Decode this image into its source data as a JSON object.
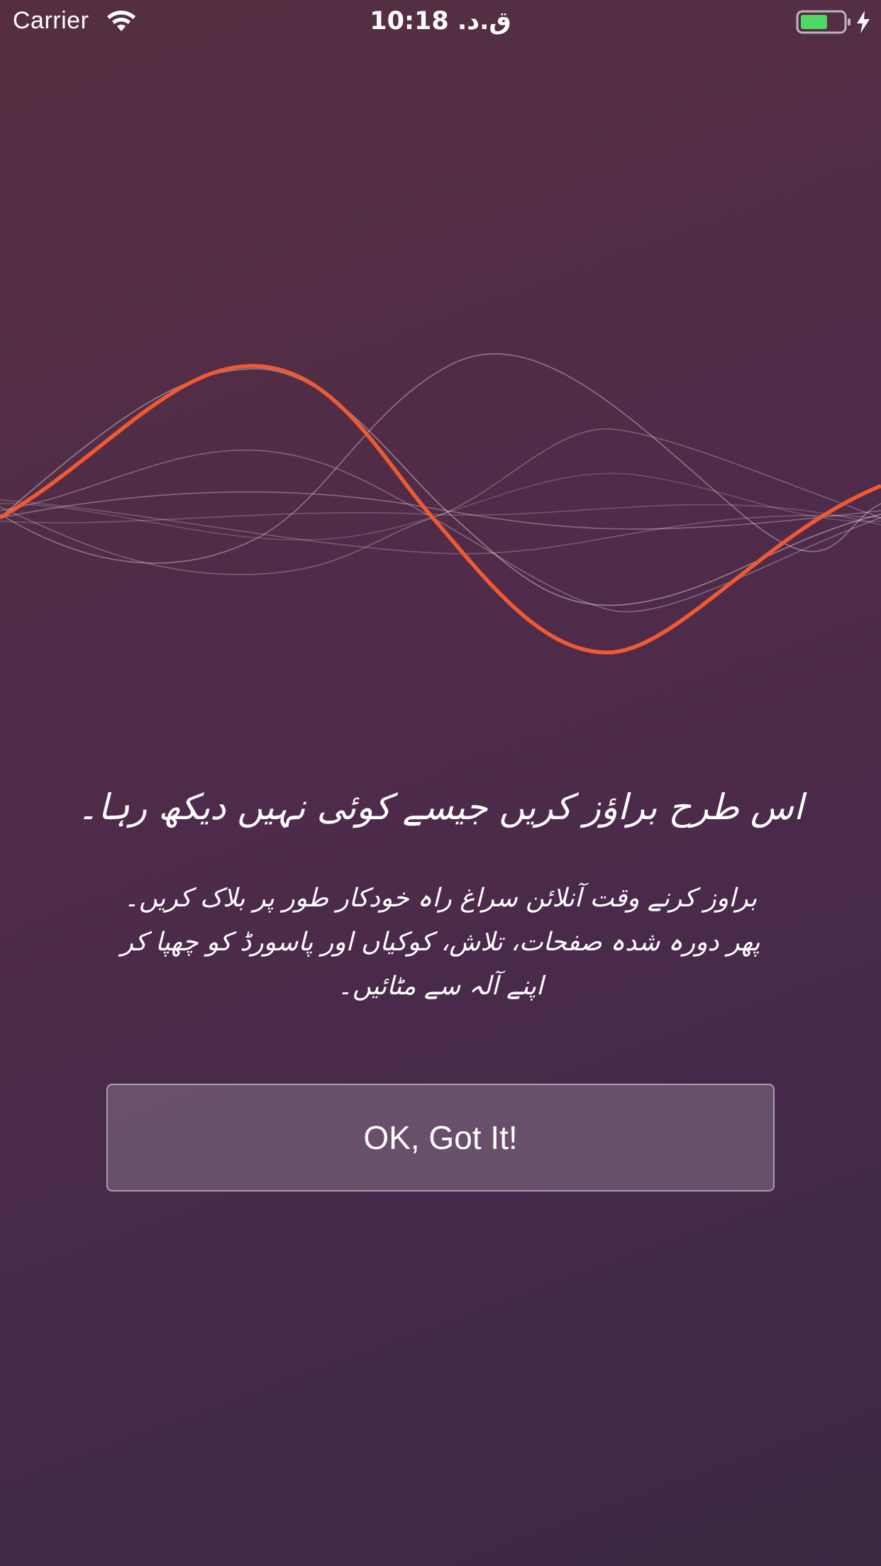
{
  "status_bar": {
    "carrier": "Carrier",
    "time": "ق.د. 10:18",
    "icons": [
      "wifi-icon",
      "battery-icon",
      "charging-bolt-icon"
    ],
    "battery_color": "#4cd964"
  },
  "onboarding": {
    "headline": "اس طرح براؤز کریں جیسے کوئی نہیں دیکھ رہا۔",
    "description": "براوز کرنے وقت آنلائن سراغ راہ خودکار طور پر بلاک کریں۔ پھر دورہ شدہ صفحات، تلاش، کوکیاں اور پاسورڈ کو چھپا کر اپنے آلہ سے مٹائیں۔",
    "ok_button_label": "OK, Got It!"
  },
  "colors": {
    "accent_wave": "#ef5a32",
    "background_top": "#552f40",
    "background_bottom": "#3a2943"
  }
}
